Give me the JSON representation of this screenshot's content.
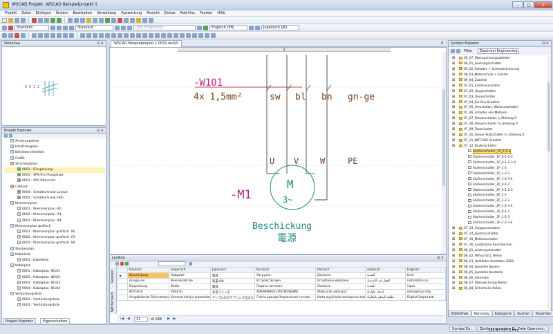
{
  "window": {
    "title": "WSCAD  Projekt: WSCAD Beispielprojekt 1"
  },
  "menu": [
    "Projekt",
    "Datei",
    "Einfügen",
    "Ändern",
    "Bearbeiten",
    "Verwaltung",
    "Auswertung",
    "Ansicht",
    "Extras",
    "Add-Ons",
    "Fenster",
    "Hilfe"
  ],
  "toolbar": {
    "style_combo": "Standard",
    "dim_combo": "Standard",
    "norm_combo": "(Von Programm)",
    "lang1_combo": "Englisch (EN)",
    "lang2_combo": "Japanisch (JA)"
  },
  "left_top": {
    "title": "Vorschau",
    "preview_text": "-S  0 1 2"
  },
  "project_explorer": {
    "title": "Projekt Explorer",
    "items": [
      {
        "text": "Änderungsliste",
        "indent": 1,
        "kind": "page"
      },
      {
        "text": "Inhaltsangabe",
        "indent": 1,
        "kind": "page"
      },
      {
        "text": "Betriebsmittelliste",
        "indent": 1,
        "kind": "page"
      },
      {
        "text": "Grafik",
        "indent": 1,
        "kind": "page"
      },
      {
        "text": "Stromlaufplan",
        "indent": 1,
        "kind": "folder"
      },
      {
        "text": "0001 : Einspeisung",
        "indent": 3,
        "kind": "sheet",
        "selected": true
      },
      {
        "text": "0002 : SPS-Ein-/Ausgänge",
        "indent": 3,
        "kind": "sheet"
      },
      {
        "text": "0003 : SPS Übersicht",
        "indent": 3,
        "kind": "sheet"
      },
      {
        "text": "Cabinet",
        "indent": 1,
        "kind": "folder"
      },
      {
        "text": "0004 : Schaltschrank Layout",
        "indent": 3,
        "kind": "sheet"
      },
      {
        "text": "0005 : Schaltschrank Foto",
        "indent": 3,
        "kind": "sheet"
      },
      {
        "text": "Klemmenplan",
        "indent": 1,
        "kind": "page"
      },
      {
        "text": "0001 : Klemmenplan -X0",
        "indent": 3,
        "kind": "page"
      },
      {
        "text": "0002 : Klemmenplan -X1",
        "indent": 3,
        "kind": "page"
      },
      {
        "text": "0003 : Klemmenplan -X4",
        "indent": 3,
        "kind": "page"
      },
      {
        "text": "Klemmenplan grafisch",
        "indent": 1,
        "kind": "page"
      },
      {
        "text": "0001 : Klemmenplan grafisch -X0",
        "indent": 3,
        "kind": "page"
      },
      {
        "text": "0002 : Klemmenplan grafisch -X1",
        "indent": 3,
        "kind": "page"
      },
      {
        "text": "0003 : Klemmenplan grafisch -X4",
        "indent": 3,
        "kind": "page"
      },
      {
        "text": "Steckerplan",
        "indent": 1,
        "kind": "page"
      },
      {
        "text": "Kabelliste",
        "indent": 1,
        "kind": "page"
      },
      {
        "text": "0001 : Kabelliste",
        "indent": 3,
        "kind": "page"
      },
      {
        "text": "Kabelplan",
        "indent": 1,
        "kind": "page"
      },
      {
        "text": "0001 : Kabelplan -W101",
        "indent": 3,
        "kind": "page"
      },
      {
        "text": "0002 : Kabelplan -W102",
        "indent": 3,
        "kind": "page"
      },
      {
        "text": "0003 : Kabelplan -W103",
        "indent": 3,
        "kind": "page"
      },
      {
        "text": "0004 : Kabelplan -W104",
        "indent": 3,
        "kind": "page"
      },
      {
        "text": "Verbindungsliste",
        "indent": 1,
        "kind": "page"
      },
      {
        "text": "0001 : Verbindungsliste",
        "indent": 3,
        "kind": "page"
      },
      {
        "text": "0002 : Verbindungsliste",
        "indent": 3,
        "kind": "page"
      }
    ],
    "tab1": "Projekt Explorer",
    "tab2": "Eigenschaften"
  },
  "doc": {
    "tab_label": "WSCAD Beispielprojekt 1.0001.wsl10",
    "ruler_mark": "3",
    "cable_ref": "-W101",
    "cable_spec": "4x 1,5mm²",
    "wire_labels": [
      "sw",
      "bl",
      "bn",
      "gn-ge"
    ],
    "terminals": [
      "U",
      "V",
      "W",
      "PE"
    ],
    "motor_ref": "-M1",
    "motor_letter": "M",
    "motor_phase": "3~",
    "label_de": "Beschickung",
    "label_zh": "電源"
  },
  "lexikon": {
    "title": "Lexikon",
    "side_tabs": [
      "Lexikon",
      "Wörterbuch"
    ],
    "columns": [
      "Deutsch",
      "Ungarisch",
      "Japanisch",
      "Russisch",
      "Polnisch",
      "Arabisch",
      "Englisch"
    ],
    "rows": [
      [
        "Beschickung",
        "Adagolás",
        "電源",
        "Загрузка",
        "Zasilanie",
        "التغذية",
        "feed"
      ],
      [
        "Anlage ein",
        "Berendezés be",
        "装置 ON",
        "Устройство вкл.",
        "Urządzenie włączone",
        "الجهاز قيد التشغيل",
        "installation on"
      ],
      [
        "Einspeisung",
        "Betáp",
        "電源",
        "Подача питания",
        "Zasilanie",
        "التغذية",
        "input"
      ],
      [
        "NOT-AUS",
        "VÉSZ-KI",
        "非常スイッチ",
        "АВАРИЙНОЕ ОТКЛЮЧЕНИЕ",
        "Wyłącznik awaryjny",
        "إيقاف طوارئ",
        "emergency stop"
      ],
      [
        "Ausgabekarte Technetsteuerung",
        "Kimenet kártya-automatizálás",
        "テーブルのステアリング出力カード",
        "Плата вывода Управление столом",
        "Karta wyjściowa sterowania stołu",
        "بطاقة التحكم بالطاولة",
        "Digital Output tab"
      ]
    ],
    "page_current": "21",
    "page_total": "of 188"
  },
  "symbol_explorer": {
    "title": "Symbol Explorer",
    "filter_label": "Filter",
    "filter_value": "Electrical Engineering",
    "items": [
      {
        "text": "05_07_Überspannungsableiter",
        "kind": "folder",
        "indent": 0
      },
      {
        "text": "06_01_Leistungsschalter",
        "kind": "folder",
        "indent": 0
      },
      {
        "text": "06_02_Schalter + Schmelzsicherung",
        "kind": "folder",
        "indent": 0
      },
      {
        "text": "06_03_Motorschutz + Starter",
        "kind": "folder",
        "indent": 0
      },
      {
        "text": "06_04_Zubehör",
        "kind": "folder",
        "indent": 0
      },
      {
        "text": "07_01_Lastrennschalter",
        "kind": "folder",
        "indent": 0
      },
      {
        "text": "07_02_Hauptschalter",
        "kind": "folder",
        "indent": 0
      },
      {
        "text": "07_03_Trennschalter",
        "kind": "folder",
        "indent": 0
      },
      {
        "text": "07_04_Ein-Aus-Schalter",
        "kind": "folder",
        "indent": 0
      },
      {
        "text": "07_05_Umschalter, Wechselschalter",
        "kind": "folder",
        "indent": 0
      },
      {
        "text": "07_06_Schalter von Motoren",
        "kind": "folder",
        "indent": 0
      },
      {
        "text": "07_07_Steuerschalter o_Stellung 0",
        "kind": "folder",
        "indent": 0
      },
      {
        "text": "07_08_Steuerschalter m_Stellung 0",
        "kind": "folder",
        "indent": 0
      },
      {
        "text": "07_09_Tastschalter",
        "kind": "folder",
        "indent": 0
      },
      {
        "text": "07_10_Steuer-Tastschalter m_Stellung 0",
        "kind": "folder",
        "indent": 0
      },
      {
        "text": "07_11_NOT-AUS Schalter",
        "kind": "folder",
        "indent": 0
      },
      {
        "text": "07_12_Stufenschalter",
        "kind": "folder",
        "indent": 0
      },
      {
        "text": "Stufenschalter_1P_0-1-2",
        "kind": "item",
        "indent": 1,
        "selected": true
      },
      {
        "text": "Stufenschalter_1P_0-1-2-3",
        "kind": "item",
        "indent": 1
      },
      {
        "text": "Stufenschalter_1P_0-1-2-3-4",
        "kind": "item",
        "indent": 1
      },
      {
        "text": "Stufenschalter_1P_1-2",
        "kind": "item",
        "indent": 1
      },
      {
        "text": "Stufenschalter_1P_1-2-3",
        "kind": "item",
        "indent": 1
      },
      {
        "text": "Stufenschalter_1P_1-2-3-4",
        "kind": "item",
        "indent": 1
      },
      {
        "text": "Stufenschalter_2P_0-1-2",
        "kind": "item",
        "indent": 1
      },
      {
        "text": "Stufenschalter_2P_0-1-2-3",
        "kind": "item",
        "indent": 1
      },
      {
        "text": "Stufenschalter_2P_1-2",
        "kind": "item",
        "indent": 1
      },
      {
        "text": "Stufenschalter_2P_1-2-3",
        "kind": "item",
        "indent": 1
      },
      {
        "text": "Stufenschalter_2P_1-2-3-4",
        "kind": "item",
        "indent": 1
      },
      {
        "text": "Stufenschalter_3P_0-1-2",
        "kind": "item",
        "indent": 1
      },
      {
        "text": "Stufenschalter_3P_1-2-3",
        "kind": "item",
        "indent": 1
      },
      {
        "text": "Stufenschalter_3P_1-2-3-4",
        "kind": "item",
        "indent": 1
      },
      {
        "text": "07_13_Gruppenschalter",
        "kind": "folder",
        "indent": 0
      },
      {
        "text": "07_14_Joystickschalter",
        "kind": "folder",
        "indent": 0
      },
      {
        "text": "07_15_Meßumschalter",
        "kind": "folder",
        "indent": 0
      },
      {
        "text": "07_16_Zusätzliche Kennzeichen",
        "kind": "folder",
        "indent": 0
      },
      {
        "text": "08_01_Leistungsschalter",
        "kind": "folder",
        "indent": 0
      },
      {
        "text": "08_02_Hilfsschütz, Relais",
        "kind": "folder",
        "indent": 0
      },
      {
        "text": "08_03_Halbleiter Kontaktor (SSR)",
        "kind": "folder",
        "indent": 0
      },
      {
        "text": "08_04_Spezielle Spulen",
        "kind": "folder",
        "indent": 0
      },
      {
        "text": "08_05_Spezielle Kontakte",
        "kind": "folder",
        "indent": 0
      },
      {
        "text": "08_06_Zeitrelais",
        "kind": "folder",
        "indent": 0
      },
      {
        "text": "08_07_Überwachungs-Relais",
        "kind": "folder",
        "indent": 0
      },
      {
        "text": "08_08_Sicherheits-Relais",
        "kind": "folder",
        "indent": 0
      }
    ],
    "tabs": [
      "Bibliothek",
      "Kennung",
      "Kategorie",
      "Suchen",
      "Favoriten"
    ]
  },
  "taskbar": {
    "items": [
      "Symbol Ex...",
      "Zeichnungsmakro Ex...",
      "Freie Querverv..."
    ],
    "coords": "122.5 / 137.5 mm"
  },
  "colors": {
    "magenta": "#c0208a",
    "teal": "#1f8a80",
    "ref_red": "#c04050",
    "wire_brown": "#7a3d18"
  }
}
